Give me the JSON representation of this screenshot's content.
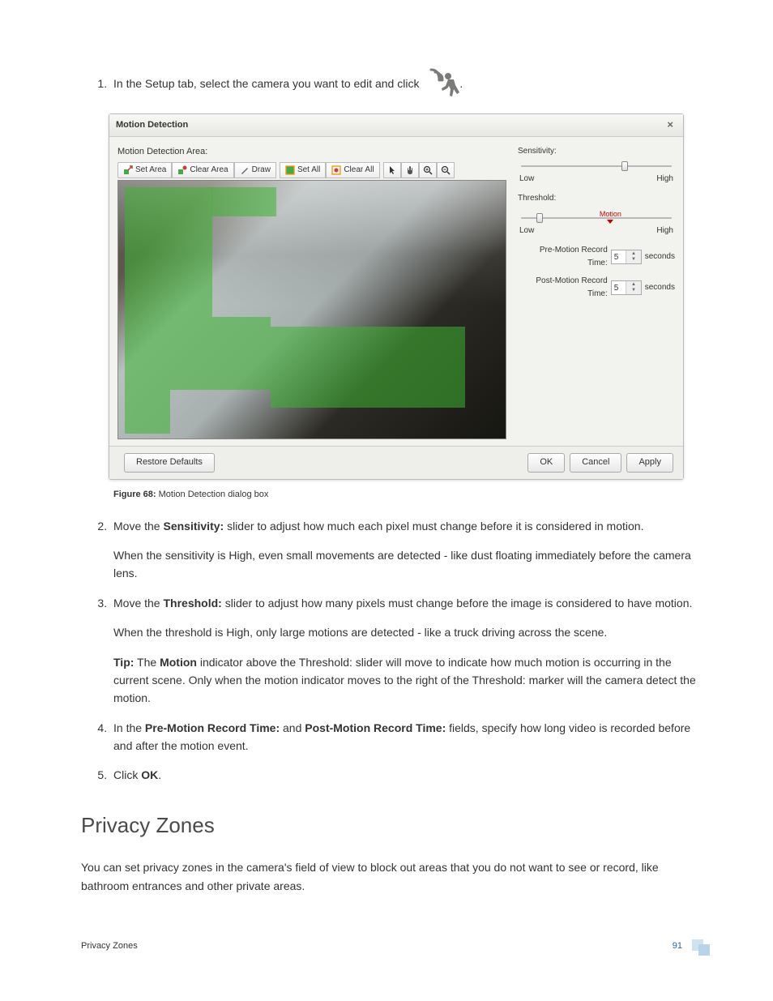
{
  "steps": {
    "s1_pre": "In the Setup tab, select the camera you want to edit and click ",
    "s1_post": ".",
    "s2a": "Move the ",
    "s2_bold": "Sensitivity:",
    "s2b": " slider to adjust how much each pixel must change before it is considered in motion.",
    "s2_para2": "When the sensitivity is High, even small movements are detected - like dust floating immediately before the camera lens.",
    "s3a": "Move the ",
    "s3_bold": "Threshold:",
    "s3b": " slider to adjust how many pixels must change before the image is considered to have motion.",
    "s3_para2": "When the threshold is High, only large motions are detected - like a truck driving across the scene.",
    "s3_tip_b1": "Tip:",
    "s3_tip_t1": " The ",
    "s3_tip_b2": "Motion",
    "s3_tip_t2": " indicator above the Threshold: slider will move to indicate how much motion is occurring in the current scene. Only when the motion indicator moves to the right of the Threshold: marker will the camera detect the motion.",
    "s4a": "In the ",
    "s4_b1": "Pre-Motion Record Time:",
    "s4b": " and ",
    "s4_b2": "Post-Motion Record Time:",
    "s4c": " fields, specify how long video is recorded before and after the motion event.",
    "s5a": "Click ",
    "s5_bold": "OK",
    "s5b": "."
  },
  "dialog": {
    "title": "Motion Detection",
    "area_label": "Motion Detection Area:",
    "toolbar": {
      "set_area": "Set Area",
      "clear_area": "Clear Area",
      "draw": "Draw",
      "set_all": "Set All",
      "clear_all": "Clear All"
    },
    "sensitivity": "Sensitivity:",
    "threshold": "Threshold:",
    "low": "Low",
    "high": "High",
    "motion": "Motion",
    "pre_motion": "Pre-Motion Record Time:",
    "post_motion": "Post-Motion Record Time:",
    "pre_val": "5",
    "post_val": "5",
    "seconds": "seconds",
    "restore": "Restore Defaults",
    "ok": "OK",
    "cancel": "Cancel",
    "apply": "Apply"
  },
  "figure": {
    "label": "Figure 68:",
    "text": " Motion Detection dialog box"
  },
  "section_heading": "Privacy Zones",
  "section_body": "You can set privacy zones in the camera's field of view to block out areas that you do not want to see or record, like bathroom entrances and other private areas.",
  "footer": {
    "left": "Privacy Zones",
    "page": "91"
  }
}
